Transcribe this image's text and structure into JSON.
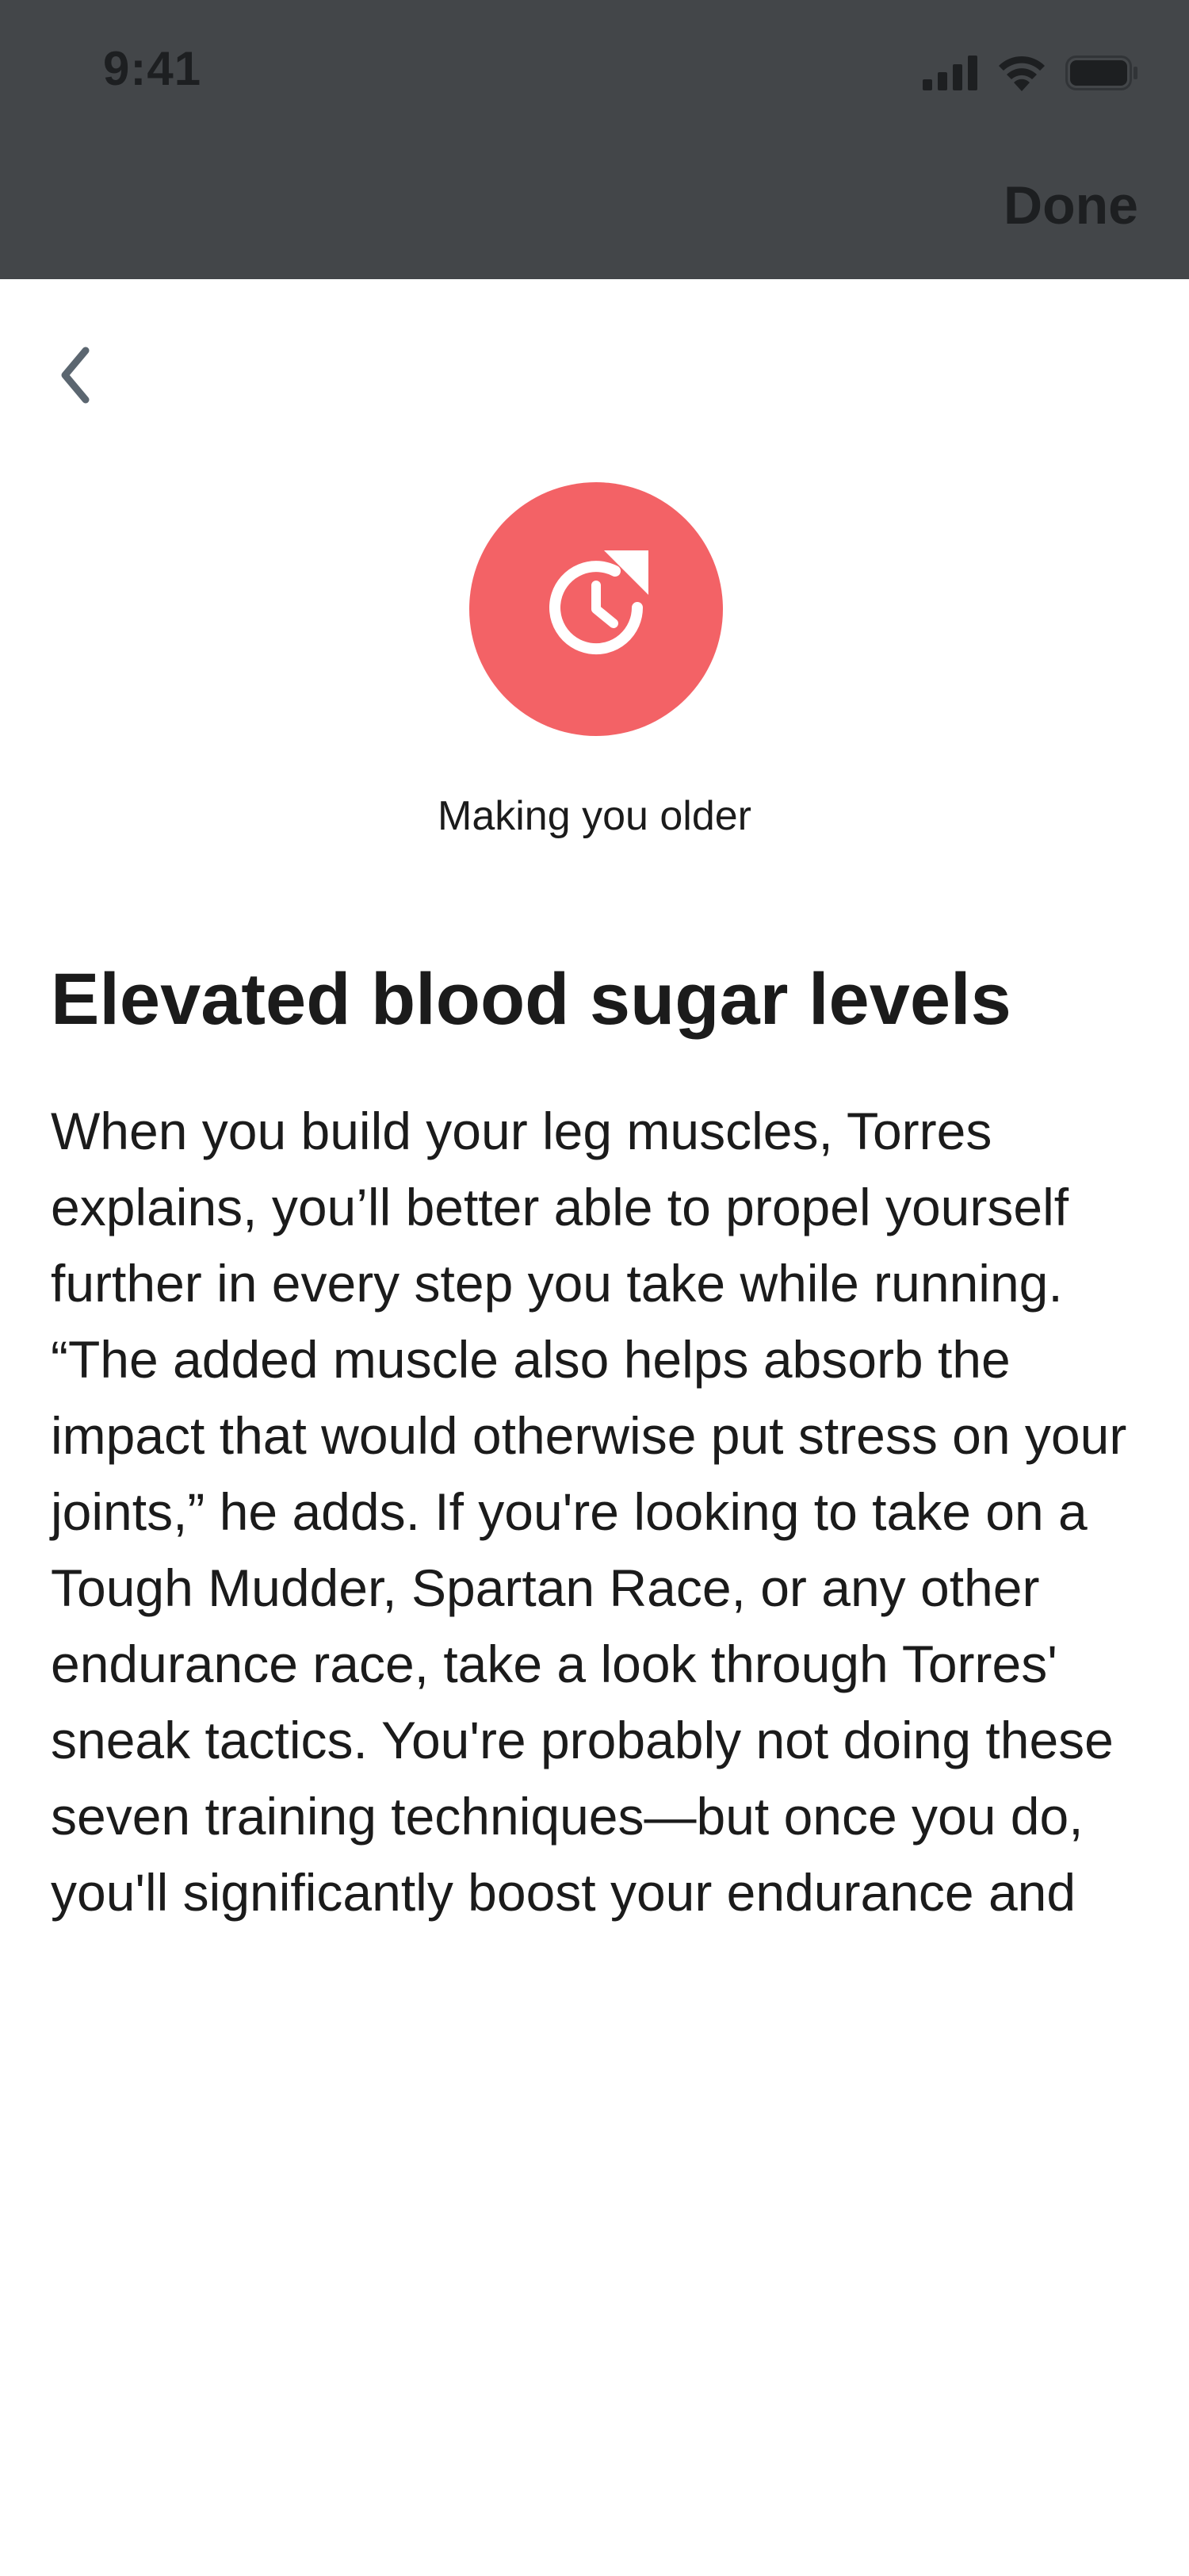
{
  "status_bar": {
    "time": "9:41",
    "icons": [
      "cellular-signal-icon",
      "wifi-icon",
      "battery-icon"
    ]
  },
  "header": {
    "done_label": "Done"
  },
  "nav": {
    "back_icon": "chevron-left-icon"
  },
  "hero": {
    "icon": "clock-refresh-icon",
    "caption": "Making you older",
    "accent_color": "#f36266"
  },
  "article": {
    "title": "Elevated blood sugar levels",
    "body": "When you build your leg muscles, Torres explains, you’ll better able to propel yourself further in every step you take while running. “The added muscle also helps absorb the impact that would otherwise put stress on your joints,” he adds. If you're looking to take on a Tough Mudder, Spartan Race, or any other endurance race, take a look through Torres' sneak tactics. You're probably not doing these seven training techniques—but once you do, you'll significantly boost your endurance and"
  },
  "colors": {
    "top_bar": "#434649",
    "text": "#1b1b1b",
    "status_text": "#1d1f21",
    "back_chevron": "#5b6670"
  }
}
